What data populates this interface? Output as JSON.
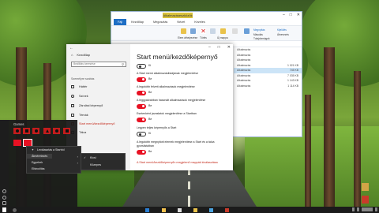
{
  "explorer": {
    "title_highlight": "Alkalmazáseszközök",
    "title": "",
    "tab_file": "Fájl",
    "tabs": [
      "Kezdőlap",
      "Megosztás",
      "Nézet",
      "Kezelés"
    ],
    "ribbon_labels": [
      "Elem áthelyezése",
      "Másolás",
      "Törlés",
      "Átnevezés",
      "Új mappa",
      "Tulajdonságok",
      "Megnyitás",
      "Kijelölés"
    ],
    "rows": [
      {
        "name": "Alkalmazás",
        "size": ""
      },
      {
        "name": "Alkalmazás",
        "size": ""
      },
      {
        "name": "Alkalmazás",
        "size": ""
      },
      {
        "name": "Alkalmazás",
        "size": "1 021 KB"
      },
      {
        "name": "Alkalmazás",
        "size": "745 KB"
      },
      {
        "name": "Alkalmazás",
        "size": "7 035 KB"
      },
      {
        "name": "Alkalmazás",
        "size": "1 143 KB"
      },
      {
        "name": "Alkalmazás",
        "size": "1 114 KB"
      }
    ],
    "status": ""
  },
  "settings": {
    "back_icon": "arrow-left-icon",
    "home_label": "Kezdőlap",
    "search_placeholder": "Beállítás keresése",
    "section_label": "Személyre szabás",
    "nav_items": [
      {
        "label": "Háttér",
        "active": false
      },
      {
        "label": "Színek",
        "active": false
      },
      {
        "label": "Zárolási képernyő",
        "active": false
      },
      {
        "label": "Témák",
        "active": false
      },
      {
        "label": "Start menü/kezdőképernyő",
        "active": true
      },
      {
        "label": "Tálca",
        "active": false
      }
    ],
    "heading": "Start menü/kezdőképernyő",
    "options": [
      {
        "label": "",
        "state": "Ki",
        "on": false
      },
      {
        "label": "A Start menü alkalmazáslistájának megjelenítése",
        "state": "Be",
        "on": true
      },
      {
        "label": "A legutóbb felvett alkalmazások megjelenítése",
        "state": "Be",
        "on": true
      },
      {
        "label": "A leggyakrabban használt alkalmazások megjelenítése",
        "state": "Be",
        "on": true
      },
      {
        "label": "Esetenként javaslatok megjelenítése a Startban",
        "state": "Be",
        "on": true
      },
      {
        "label": "Legyen teljes képernyős a Start",
        "state": "Ki",
        "on": false
      },
      {
        "label": "A legutóbb megnyitott elemek megjelenítése a Start és a tálca gyorslistáiban",
        "state": "Be",
        "on": true
      }
    ],
    "link": "A Start menü/kezdőképernyőn megjelenő mappák kiválasztása",
    "accent_color": "#e81123"
  },
  "start_menu": {
    "header": "Games"
  },
  "context_menu": {
    "items": [
      "Leválasztás a Startról",
      "Átméretezés",
      "Egyebek",
      "Eltávolítás"
    ],
    "submenu": [
      "Kicsi",
      "Közepes"
    ]
  },
  "desktop": {
    "shortcuts": [
      "",
      ""
    ]
  }
}
